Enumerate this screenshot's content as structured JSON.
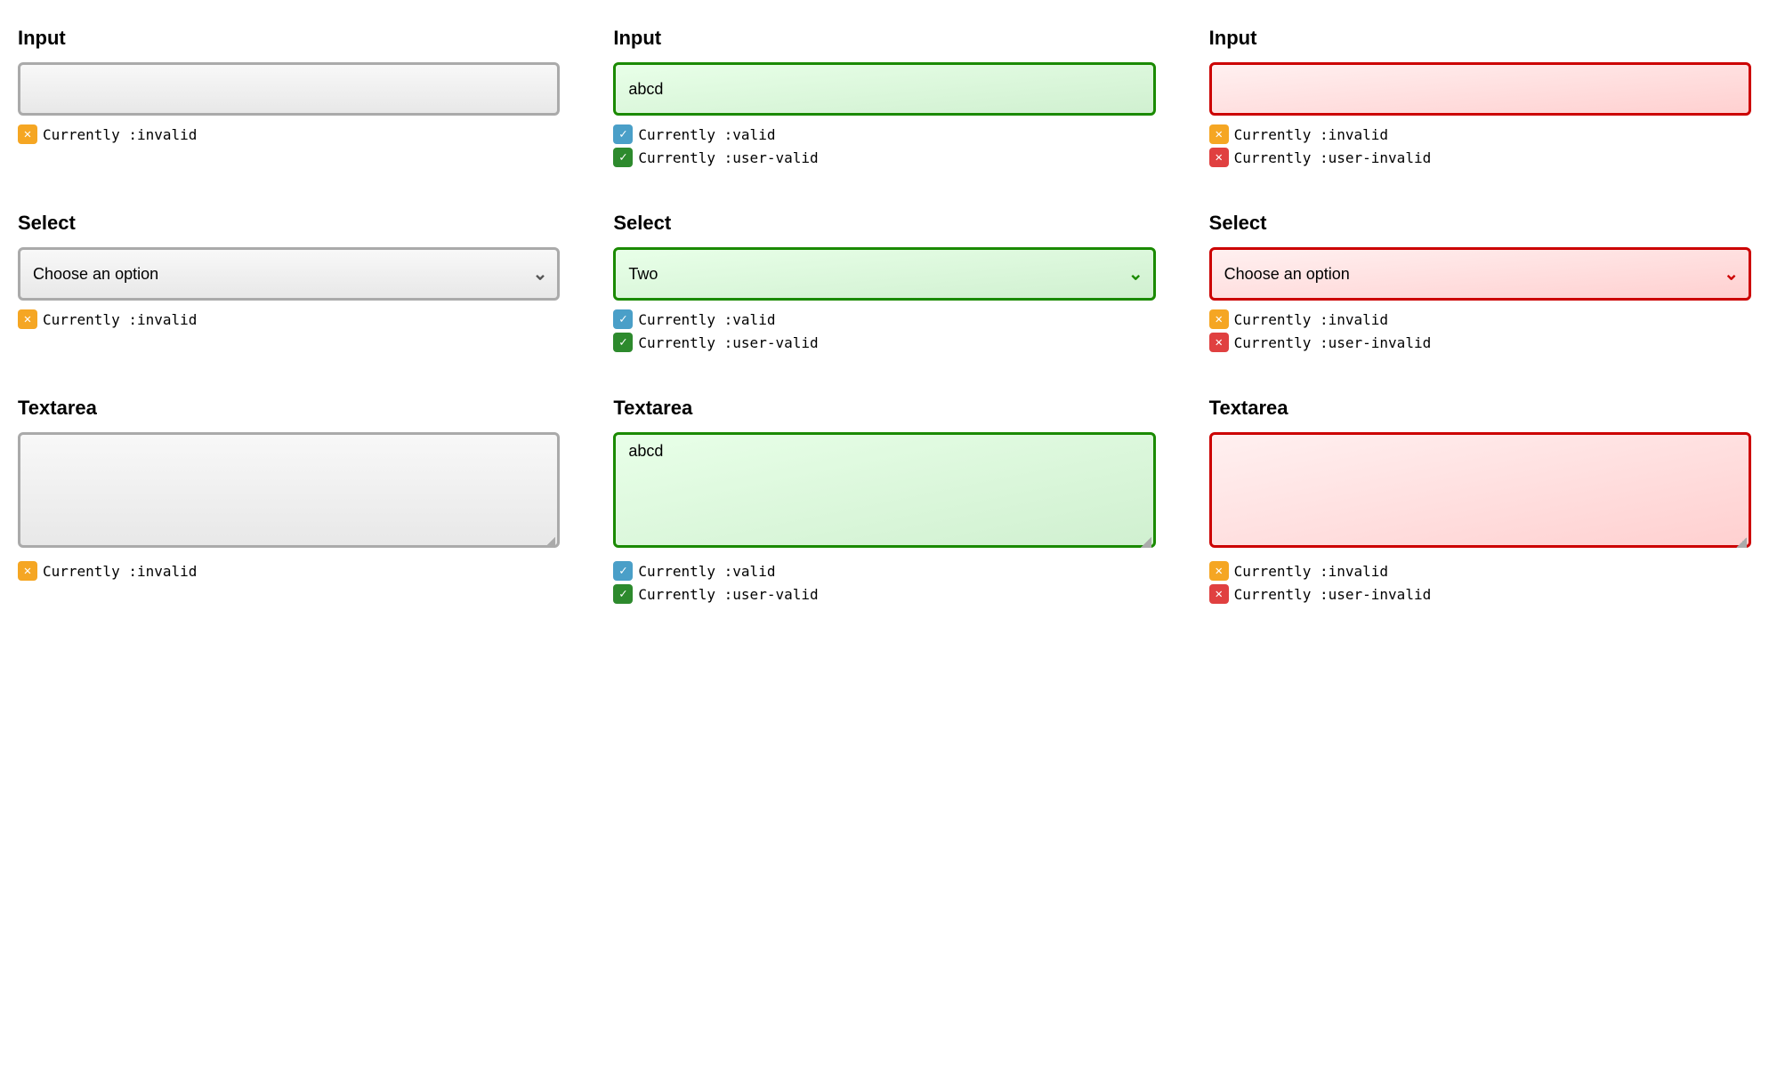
{
  "page": {
    "columns": [
      {
        "id": "col-default",
        "rows": [
          {
            "type": "input",
            "label": "Input",
            "state": "default",
            "value": "",
            "placeholder": "",
            "statuses": [
              {
                "badge": "orange",
                "text": "Currently :invalid"
              }
            ]
          },
          {
            "type": "select",
            "label": "Select",
            "state": "default",
            "value": "Choose an option",
            "options": [
              "Choose an option"
            ],
            "statuses": [
              {
                "badge": "orange",
                "text": "Currently :invalid"
              }
            ]
          },
          {
            "type": "textarea",
            "label": "Textarea",
            "state": "default",
            "value": "",
            "statuses": [
              {
                "badge": "orange",
                "text": "Currently :invalid"
              }
            ]
          }
        ]
      },
      {
        "id": "col-valid",
        "rows": [
          {
            "type": "input",
            "label": "Input",
            "state": "valid",
            "value": "abcd",
            "placeholder": "",
            "statuses": [
              {
                "badge": "blue",
                "text": "Currently :valid"
              },
              {
                "badge": "green",
                "text": "Currently :user-valid"
              }
            ]
          },
          {
            "type": "select",
            "label": "Select",
            "state": "valid",
            "value": "Two",
            "options": [
              "Two"
            ],
            "statuses": [
              {
                "badge": "blue",
                "text": "Currently :valid"
              },
              {
                "badge": "green",
                "text": "Currently :user-valid"
              }
            ]
          },
          {
            "type": "textarea",
            "label": "Textarea",
            "state": "valid",
            "value": "abcd",
            "statuses": [
              {
                "badge": "blue",
                "text": "Currently :valid"
              },
              {
                "badge": "green",
                "text": "Currently :user-valid"
              }
            ]
          }
        ]
      },
      {
        "id": "col-invalid",
        "rows": [
          {
            "type": "input",
            "label": "Input",
            "state": "invalid-red",
            "value": "",
            "placeholder": "",
            "statuses": [
              {
                "badge": "orange",
                "text": "Currently :invalid"
              },
              {
                "badge": "red",
                "text": "Currently :user-invalid"
              }
            ]
          },
          {
            "type": "select",
            "label": "Select",
            "state": "invalid-red",
            "value": "Choose an option",
            "options": [
              "Choose an option"
            ],
            "statuses": [
              {
                "badge": "orange",
                "text": "Currently :invalid"
              },
              {
                "badge": "red",
                "text": "Currently :user-invalid"
              }
            ]
          },
          {
            "type": "textarea",
            "label": "Textarea",
            "state": "invalid-red",
            "value": "",
            "statuses": [
              {
                "badge": "orange",
                "text": "Currently :invalid"
              },
              {
                "badge": "red",
                "text": "Currently :user-invalid"
              }
            ]
          }
        ]
      }
    ],
    "badge_symbols": {
      "orange": "✕",
      "blue": "✓",
      "green": "✓",
      "red": "✕"
    },
    "chevron": "∨"
  }
}
